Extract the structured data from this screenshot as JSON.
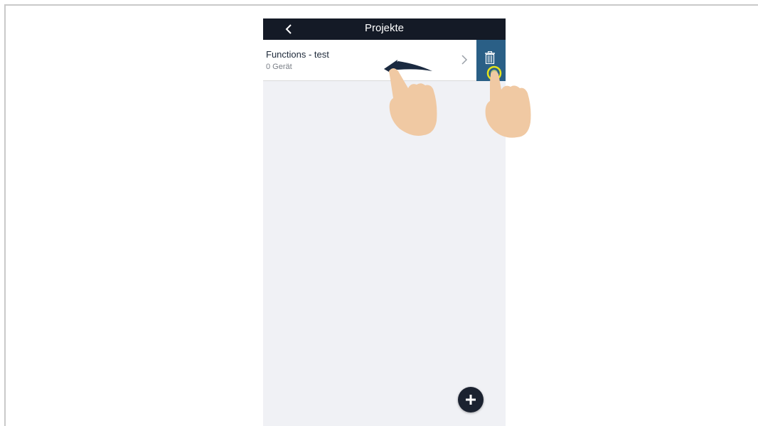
{
  "nav": {
    "title": "Projekte",
    "back_icon": "chevron-left-icon"
  },
  "project_list": {
    "items": [
      {
        "title": "Functions - test",
        "subtitle": "0 Gerät"
      }
    ]
  },
  "actions": {
    "delete_icon": "trash-icon",
    "add_icon": "plus-icon"
  },
  "colors": {
    "navbar": "#141a26",
    "delete_action": "#2a5f86",
    "background": "#f0f1f5",
    "highlight_ring": "#e6e51a",
    "hand": "#f0c9a3"
  }
}
